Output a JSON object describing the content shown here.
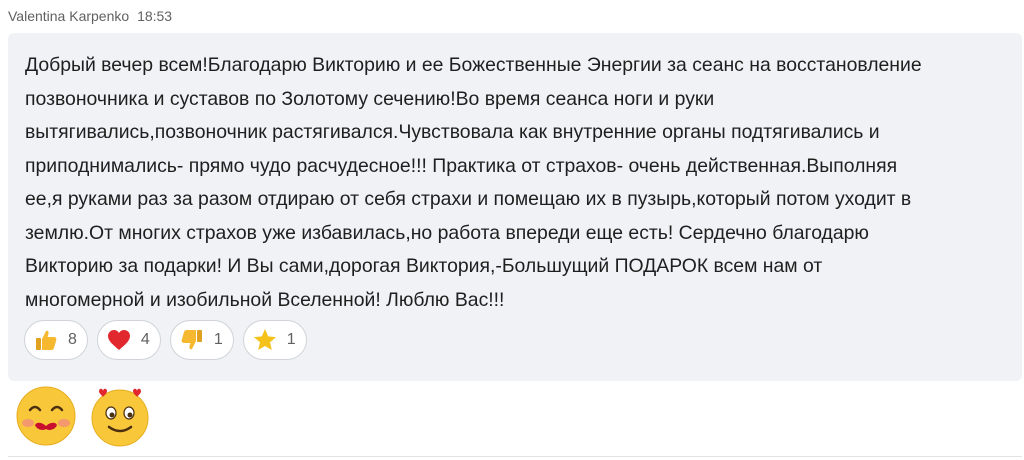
{
  "message": {
    "author": "Valentina Karpenko",
    "time": "18:53",
    "text": "Добрый вечер всем!Благодарю Викторию и ее Божественные Энергии за сеанс на восстановление\nпозвоночника и суставов по Золотому сечению!Во время сеанса ноги и руки\nвытягивались,позвоночник растягивался.Чувствовала как внутренние органы подтягивались и\nприподнимались- прямо чудо расчудесное!!! Практика от страхов- очень действенная.Выполняя\nее,я руками раз за разом отдираю от себя страхи и помещаю их в пузырь,который потом уходит в\nземлю.От многих страхов уже избавилась,но работа впереди еще есть! Сердечно благодарю\nВикторию за подарки! И Вы сами,дорогая Виктория,-Большущий ПОДАРОК всем нам от\nмногомерной и изобильной Вселенной! Люблю Вас!!!"
  },
  "reactions": [
    {
      "icon": "thumbs-up-icon",
      "count": "8"
    },
    {
      "icon": "heart-icon",
      "count": "4"
    },
    {
      "icon": "thumbs-down-icon",
      "count": "1"
    },
    {
      "icon": "star-icon",
      "count": "1"
    }
  ],
  "stickers": [
    "kissing-face-icon",
    "heart-eyes-face-icon"
  ],
  "colors": {
    "bubble": "#f0f2f5",
    "text": "#1f1f1f",
    "meta": "#616161",
    "like": "#f5b82e",
    "heart": "#e0282e",
    "star": "#f4c21b"
  }
}
